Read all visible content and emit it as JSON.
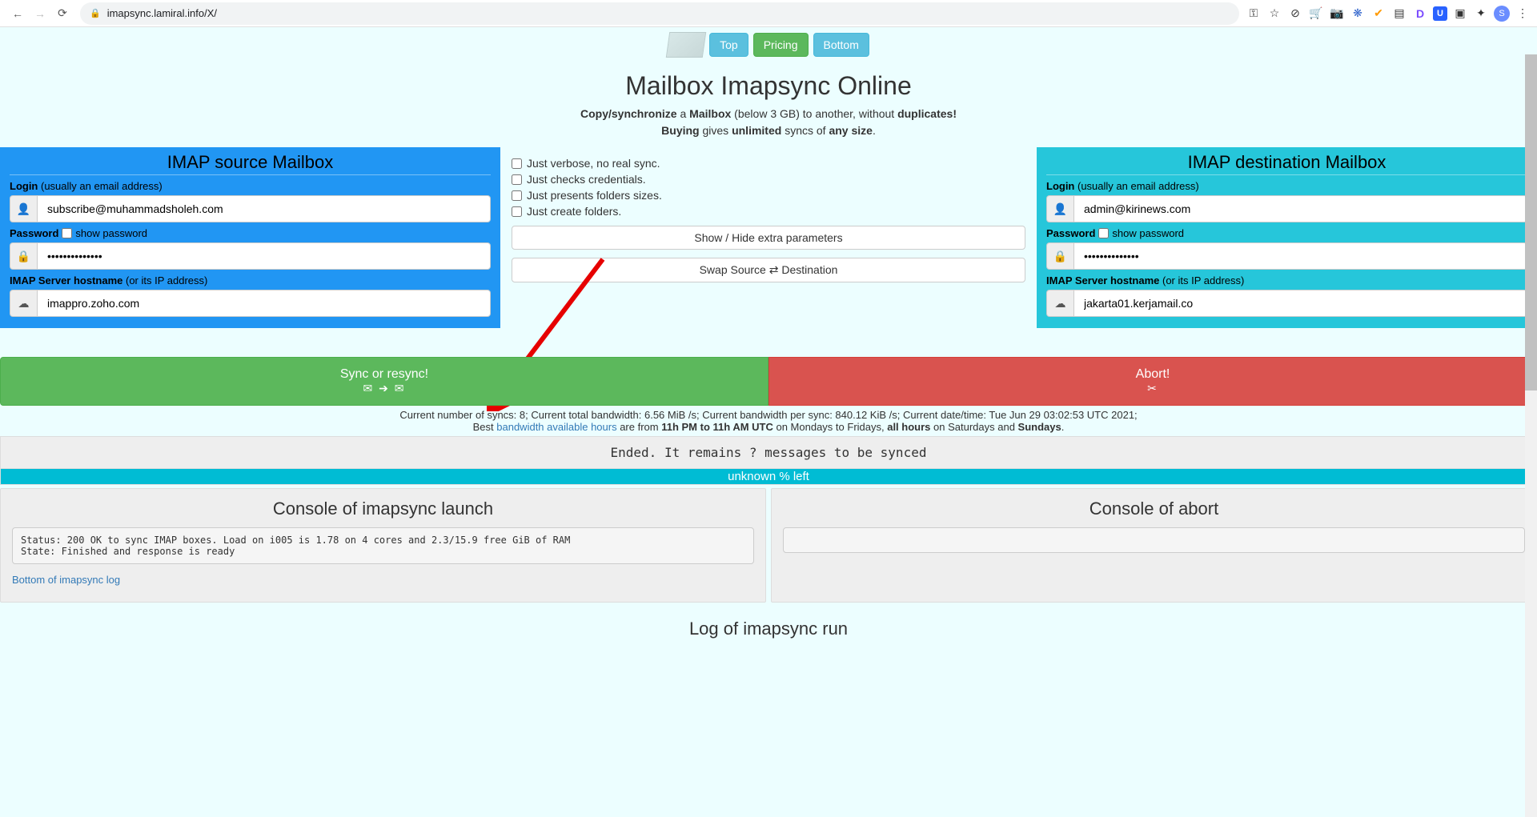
{
  "browser": {
    "url": "imapsync.lamiral.info/X/",
    "lock": true,
    "avatar_initial": "S",
    "icons": [
      "⊘",
      "🛒",
      "📷",
      "❋",
      "✔",
      "▤",
      "D",
      "U",
      "▣",
      "✦",
      "⋮"
    ]
  },
  "nav": {
    "top": "Top",
    "pricing": "Pricing",
    "bottom": "Bottom"
  },
  "title": "Mailbox Imapsync Online",
  "sub1": {
    "s1": "Copy/synchronize",
    "s2": " a ",
    "s3": "Mailbox",
    "s4": " (below 3 GB) to another, without ",
    "s5": "duplicates!"
  },
  "sub2": {
    "s1": "Buying",
    "s2": " gives ",
    "s3": "unlimited",
    "s4": " syncs of ",
    "s5": "any size",
    "s6": "."
  },
  "source": {
    "title": "IMAP source Mailbox",
    "login_label": "Login",
    "login_hint": " (usually an email address)",
    "login_value": "subscribe@muhammadsholeh.com",
    "password_label": "Password",
    "show_pw": " show password",
    "password_value": "••••••••••••••",
    "host_label": "IMAP Server hostname",
    "host_hint": " (or its IP address)",
    "host_value": "imappro.zoho.com"
  },
  "dest": {
    "title": "IMAP destination Mailbox",
    "login_label": "Login",
    "login_hint": " (usually an email address)",
    "login_value": "admin@kirinews.com",
    "password_label": "Password",
    "show_pw": " show password",
    "password_value": "••••••••••••••",
    "host_label": "IMAP Server hostname",
    "host_hint": " (or its IP address)",
    "host_value": "jakarta01.kerjamail.co"
  },
  "mid": {
    "opt1": "Just verbose, no real sync.",
    "opt2": "Just checks credentials.",
    "opt3": "Just presents folders sizes.",
    "opt4": "Just create folders.",
    "btn_show": "Show / Hide extra parameters",
    "btn_swap_pre": "Swap Source ",
    "btn_swap_post": " Destination"
  },
  "actions": {
    "sync": "Sync or resync!",
    "sync_icons": "✉ ➔ ✉",
    "abort": "Abort!",
    "abort_icon": "✂"
  },
  "status": {
    "line1": "Current number of syncs: 8; Current total bandwidth: 6.56 MiB /s; Current bandwidth per sync: 840.12 KiB /s; Current date/time: Tue Jun 29 03:02:53 UTC 2021;",
    "line2a": "Best ",
    "line2link": "bandwidth available hours",
    "line2b": " are from ",
    "line2c": "11h PM to 11h AM UTC",
    "line2d": " on Mondays to Fridays, ",
    "line2e": "all hours",
    "line2f": " on Saturdays and ",
    "line2g": "Sundays",
    "ended": "Ended. It remains ? messages to be synced",
    "progress": "unknown % left"
  },
  "consoles": {
    "launch_title": "Console of imapsync launch",
    "launch_output": "Status: 200 OK to sync IMAP boxes. Load on i005 is 1.78 on 4 cores and 2.3/15.9 free GiB of RAM\nState: Finished and response is ready",
    "launch_link": "Bottom of imapsync log",
    "abort_title": "Console of abort"
  },
  "log_title": "Log of imapsync run"
}
